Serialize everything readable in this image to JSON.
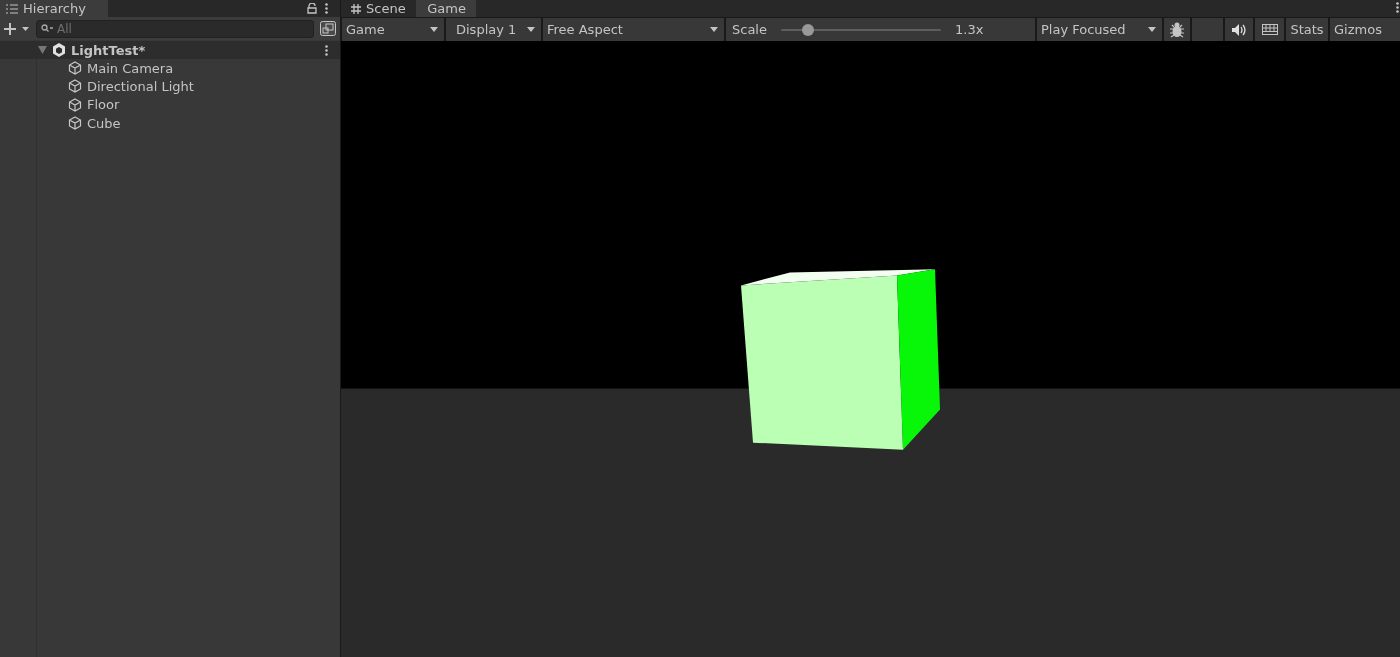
{
  "hierarchy": {
    "tab": {
      "label": "Hierarchy",
      "selected": true
    },
    "search": {
      "placeholder": "All"
    },
    "scene": {
      "name": "LightTest*",
      "expanded": true,
      "children": [
        {
          "name": "Main Camera"
        },
        {
          "name": "Directional Light"
        },
        {
          "name": "Floor"
        },
        {
          "name": "Cube"
        }
      ]
    }
  },
  "tabs": [
    {
      "label": "Scene",
      "kind": "scene",
      "selected": false
    },
    {
      "label": "Game",
      "kind": "game",
      "selected": true
    }
  ],
  "toolbar": {
    "view": "Game",
    "display": "Display 1",
    "aspect": "Free Aspect",
    "scale": {
      "label": "Scale",
      "level": 0.17,
      "reading": "1.3x"
    },
    "play_mode": "Play Focused",
    "stats": "Stats",
    "gizmos": "Gizmos"
  }
}
